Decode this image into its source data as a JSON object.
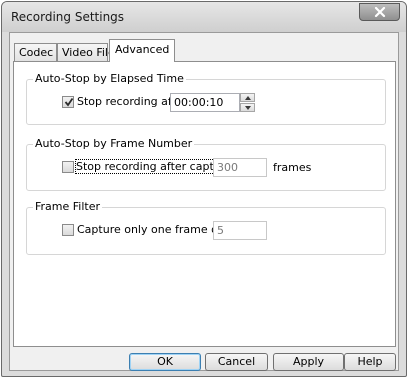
{
  "window": {
    "title": "Recording Settings"
  },
  "tabs": [
    {
      "label": "Codec",
      "active": false
    },
    {
      "label": "Video File",
      "active": false
    },
    {
      "label": "Advanced",
      "active": true
    }
  ],
  "groups": {
    "elapsed_time": {
      "title": "Auto-Stop by Elapsed Time",
      "checkbox_label": "Stop recording after",
      "checked": true,
      "value": "00:00:10"
    },
    "frame_number": {
      "title": "Auto-Stop by Frame Number",
      "checkbox_label": "Stop recording after capturing",
      "checked": false,
      "value": "300",
      "unit": "frames"
    },
    "frame_filter": {
      "title": "Frame Filter",
      "checkbox_label": "Capture only one frame out of",
      "checked": false,
      "value": "5"
    }
  },
  "buttons": {
    "ok": "OK",
    "cancel": "Cancel",
    "apply": "Apply",
    "help": "Help"
  },
  "icons": {
    "close": "close-icon",
    "check": "checkmark-icon",
    "spin_up": "arrow-up-icon",
    "spin_down": "arrow-down-icon"
  }
}
